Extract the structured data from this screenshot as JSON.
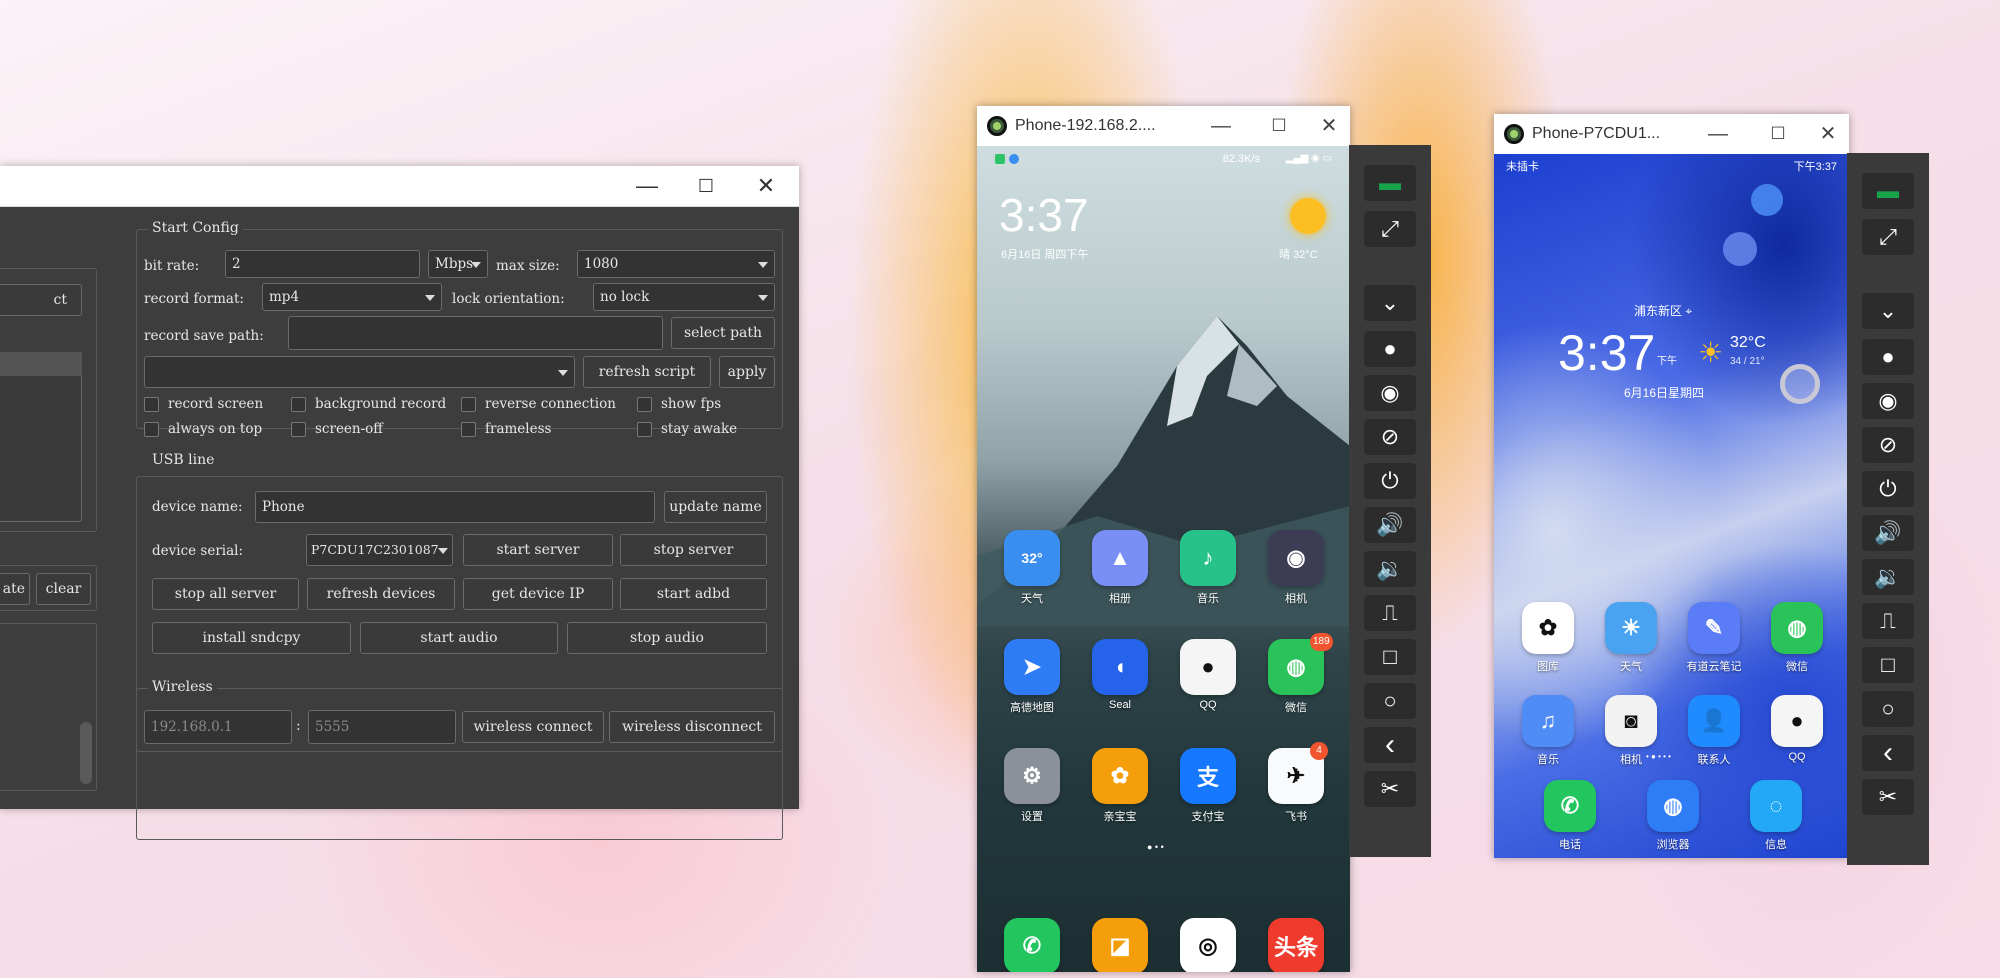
{
  "main_window": {
    "buttons": {
      "minimize": "—",
      "maximize": "☐",
      "close": "✕"
    },
    "left_panel": {
      "button_partial": "ct",
      "update_partial": "ate",
      "clear": "clear"
    },
    "start_config": {
      "title": "Start Config",
      "bit_rate_label": "bit rate:",
      "bit_rate_value": "2",
      "bit_rate_unit": "Mbps",
      "max_size_label": "max size:",
      "max_size_value": "1080",
      "record_format_label": "record format:",
      "record_format_value": "mp4",
      "lock_orientation_label": "lock orientation:",
      "lock_orientation_value": "no lock",
      "record_save_path_label": "record save path:",
      "record_save_path_value": "",
      "select_path": "select path",
      "script_value": "",
      "refresh_script": "refresh script",
      "apply": "apply",
      "checkboxes": [
        "record screen",
        "background record",
        "reverse connection",
        "show fps",
        "always on top",
        "screen-off",
        "frameless",
        "stay awake"
      ]
    },
    "usb_line": {
      "title": "USB line",
      "device_name_label": "device name:",
      "device_name_value": "Phone",
      "update_name": "update name",
      "device_serial_label": "device serial:",
      "device_serial_value": "P7CDU17C2301087",
      "start_server": "start server",
      "stop_server": "stop server",
      "stop_all_server": "stop all server",
      "refresh_devices": "refresh devices",
      "get_device_ip": "get device IP",
      "start_adbd": "start adbd",
      "install_sndcpy": "install sndcpy",
      "start_audio": "start audio",
      "stop_audio": "stop audio"
    },
    "wireless": {
      "title": "Wireless",
      "ip_placeholder": "192.168.0.1",
      "separator": ":",
      "port_placeholder": "5555",
      "wireless_connect": "wireless connect",
      "wireless_disconnect": "wireless disconnect"
    }
  },
  "phone1": {
    "title": "Phone-192.168.2....",
    "status_right": "82.3K/s",
    "clock": "3:37",
    "date": "6月16日 周四下午",
    "weather_temp": "32°C",
    "weather_prefix": "晴",
    "apps": [
      {
        "label": "天气",
        "glyph": "32°",
        "color": "#3a8ef0"
      },
      {
        "label": "相册",
        "glyph": "▲",
        "color": "#7a8ff5"
      },
      {
        "label": "音乐",
        "glyph": "♪",
        "color": "#27c28a"
      },
      {
        "label": "相机",
        "glyph": "◉",
        "color": "#3c3c55"
      },
      {
        "label": "高德地图",
        "glyph": "➤",
        "color": "#2d7cf6"
      },
      {
        "label": "Seal",
        "glyph": "◖",
        "color": "#2563eb"
      },
      {
        "label": "QQ",
        "glyph": "●",
        "color": "#f5f5f5"
      },
      {
        "label": "微信",
        "glyph": "◍",
        "color": "#29c35a",
        "badge": "189"
      },
      {
        "label": "设置",
        "glyph": "⚙",
        "color": "#8b9099"
      },
      {
        "label": "亲宝宝",
        "glyph": "✿",
        "color": "#f59e0b"
      },
      {
        "label": "支付宝",
        "glyph": "支",
        "color": "#1677ff"
      },
      {
        "label": "飞书",
        "glyph": "✈",
        "color": "#f8fafc",
        "badge": "4"
      }
    ],
    "dock": [
      {
        "label": "phone",
        "glyph": "✆",
        "color": "#22c55e"
      },
      {
        "label": "notes",
        "glyph": "◪",
        "color": "#f59e0b"
      },
      {
        "label": "chrome",
        "glyph": "◎",
        "color": "#ffffff"
      },
      {
        "label": "toutiao",
        "glyph": "头条",
        "color": "#ef3b2d"
      }
    ]
  },
  "phone2": {
    "title": "Phone-P7CDU1...",
    "status_left": "未插卡",
    "status_right": "下午3:37",
    "location": "浦东新区",
    "clock": "3:37",
    "clock_suffix": "下午",
    "weather_temp": "32°C",
    "weather_range": "34 / 21°",
    "date": "6月16日星期四",
    "apps": [
      {
        "label": "图库",
        "glyph": "✿",
        "color": "#ffffff"
      },
      {
        "label": "天气",
        "glyph": "☀",
        "color": "#4aa3f0"
      },
      {
        "label": "有道云笔记",
        "glyph": "✎",
        "color": "#5b7cf7"
      },
      {
        "label": "微信",
        "glyph": "◍",
        "color": "#29c35a"
      },
      {
        "label": "音乐",
        "glyph": "♫",
        "color": "#4f8cf5"
      },
      {
        "label": "相机",
        "glyph": "◙",
        "color": "#f2f2f2"
      },
      {
        "label": "联系人",
        "glyph": "👤",
        "color": "#1f8bff"
      },
      {
        "label": "QQ",
        "glyph": "●",
        "color": "#f5f5f5"
      }
    ],
    "dock": [
      {
        "label": "电话",
        "glyph": "✆",
        "color": "#22c55e"
      },
      {
        "label": "浏览器",
        "glyph": "◍",
        "color": "#2e7df6"
      },
      {
        "label": "信息",
        "glyph": "◌",
        "color": "#22a8f5"
      }
    ]
  },
  "toolbar_icons": [
    "keyboard-icon",
    "fullscreen-icon",
    "chevrons-down-icon",
    "record-icon",
    "eye-icon",
    "eye-off-icon",
    "power-icon",
    "volume-up-icon",
    "volume-down-icon",
    "switch-icon",
    "square-icon",
    "circle-icon",
    "back-icon",
    "scissors-icon"
  ]
}
